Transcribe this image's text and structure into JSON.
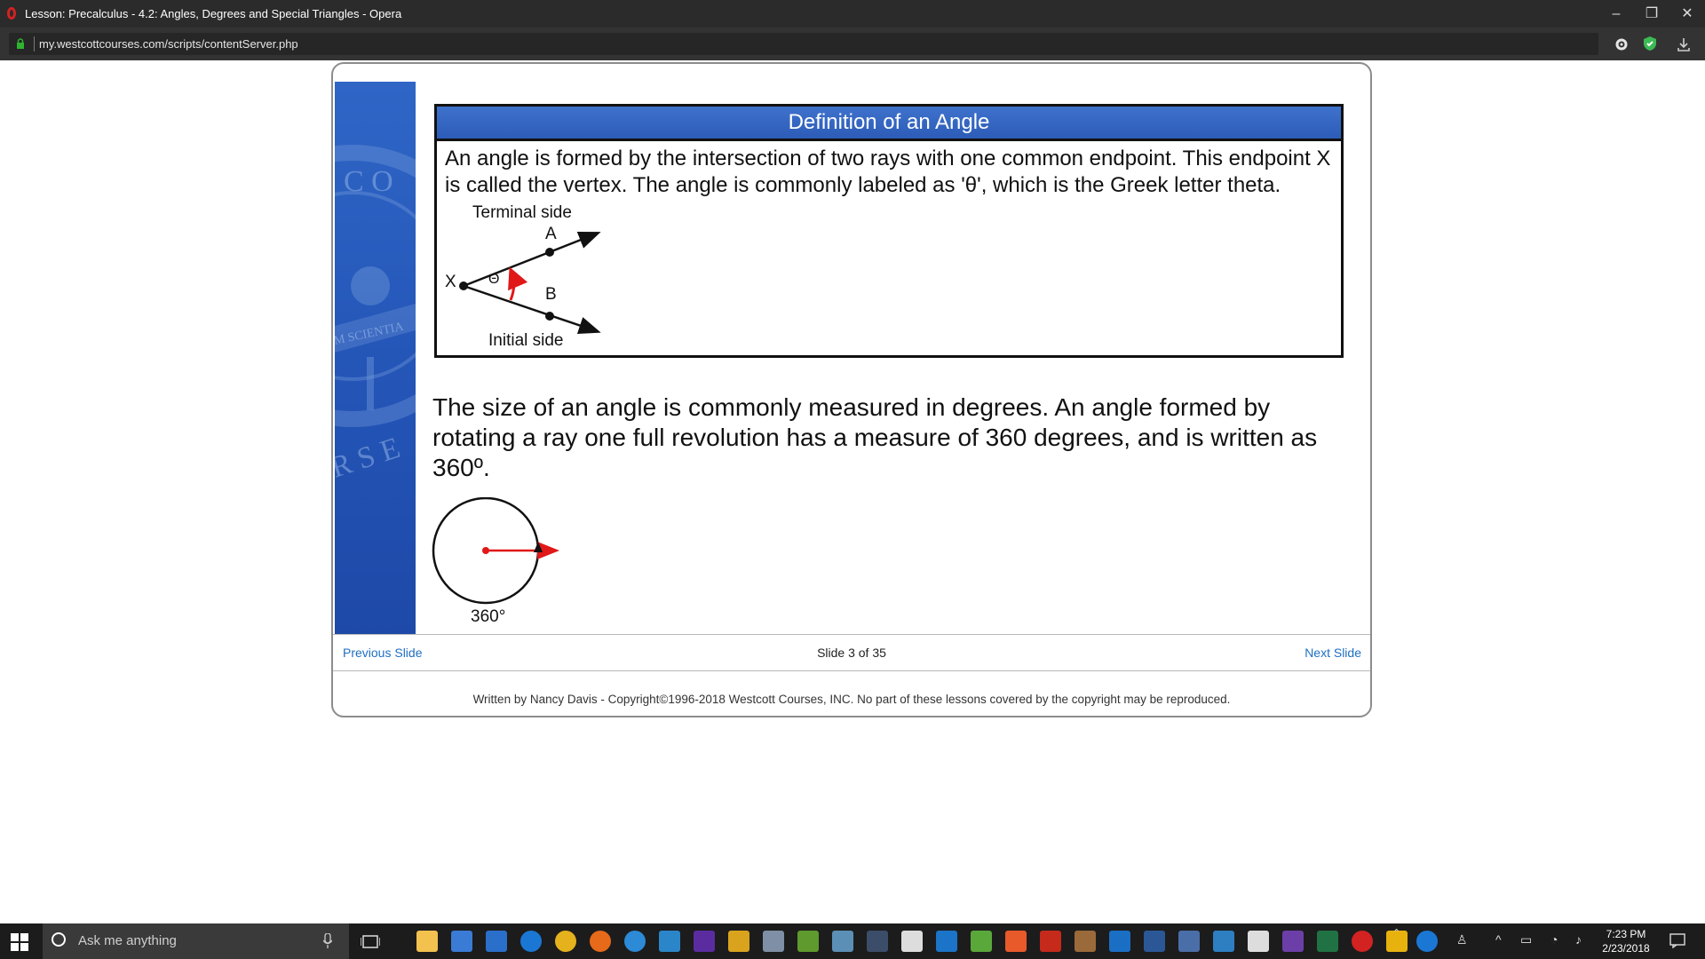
{
  "window": {
    "title": "Lesson: Precalculus - 4.2: Angles, Degrees and Special Triangles - Opera",
    "url": "my.westcottcourses.com/scripts/contentServer.php"
  },
  "sidebar": {
    "watermark": [
      "C O",
      "M SCIENTIA",
      "R S E"
    ]
  },
  "definition": {
    "header": "Definition of an Angle",
    "text": "An angle is formed by the intersection of two rays with one common endpoint.  This endpoint X is called the vertex.  The angle is commonly labeled as 'θ', which is the Greek letter theta.",
    "terminal_label": "Terminal side",
    "initial_label": "Initial side",
    "point_a": "A",
    "point_b": "B",
    "point_x": "X",
    "theta": "Θ"
  },
  "degrees": {
    "text": "The size of an angle is commonly measured in degrees.  An angle formed by rotating a ray one full revolution has a measure of 360 degrees, and is written as 360º.",
    "circle_label": "360°"
  },
  "nav": {
    "previous": "Previous Slide",
    "slide_count": "Slide 3 of 35",
    "next": "Next Slide"
  },
  "footer": "Written by Nancy Davis - Copyright©1996-2018 Westcott Courses, INC. No part of these lessons covered by the copyright may be reproduced.",
  "taskbar": {
    "search_placeholder": "Ask me anything",
    "time": "7:23 PM",
    "date": "2/23/2018"
  },
  "colors": {
    "accent_blue": "#2c5cb8",
    "ray_red": "#e01818",
    "link_blue": "#1f6fc2"
  }
}
